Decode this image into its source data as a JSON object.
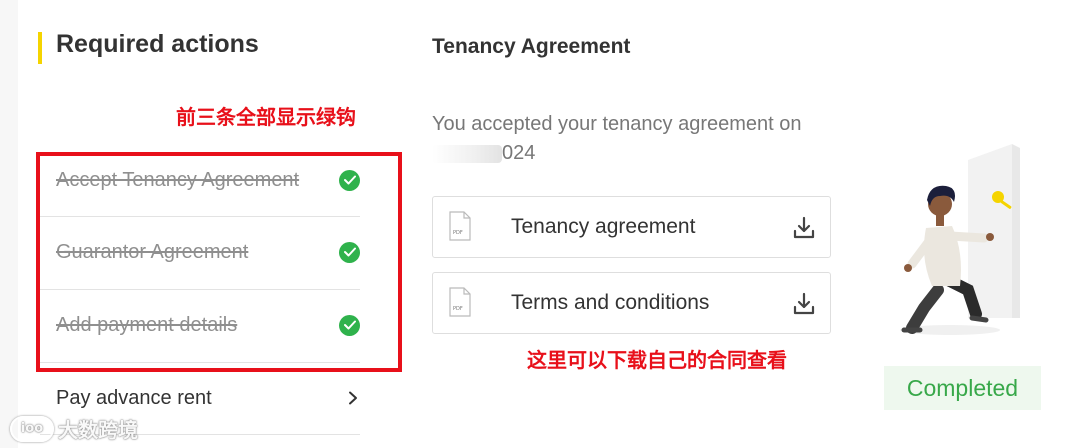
{
  "required_actions": {
    "title": "Required actions",
    "items": [
      {
        "label": "Accept Tenancy Agreement",
        "status": "done"
      },
      {
        "label": "Guarantor Agreement",
        "status": "done"
      },
      {
        "label": "Add payment details",
        "status": "done"
      },
      {
        "label": "Pay advance rent",
        "status": "pending"
      }
    ]
  },
  "tenancy": {
    "title": "Tenancy Agreement",
    "accepted_line1": "You accepted your tenancy agreement on",
    "accepted_line2_visible": "024",
    "documents": [
      {
        "label": "Tenancy agreement",
        "icon": "pdf-icon",
        "action_icon": "download-icon"
      },
      {
        "label": "Terms and conditions",
        "icon": "pdf-icon",
        "action_icon": "download-icon"
      }
    ]
  },
  "status": {
    "label": "Completed"
  },
  "annotations": {
    "top": "前三条全部显示绿钩",
    "bottom": "这里可以下载自己的合同查看"
  },
  "watermark": {
    "logo": "ioo",
    "text": "大数跨境"
  },
  "colors": {
    "accent": "#f5d400",
    "check_green": "#2fb24c",
    "annotation_red": "#e8101a",
    "completed_bg": "#eef8ee",
    "completed_text": "#38a84a"
  }
}
